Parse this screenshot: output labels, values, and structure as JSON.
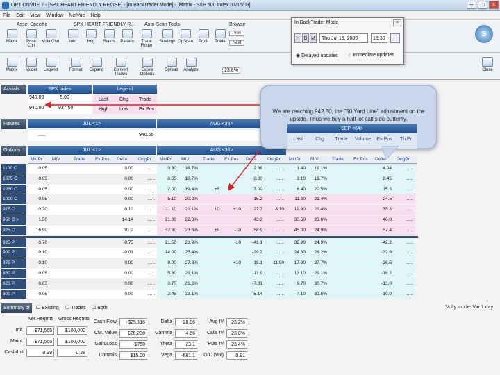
{
  "window": {
    "title": "OPTIONVUE 7 - [SPX HEART FRIENDLY REVISE] - [In BackTrader Mode] - [Matrix - S&P 500 Index 07/15/09]"
  },
  "menu": [
    "File",
    "Edit",
    "View",
    "Window",
    "NetVue",
    "Help"
  ],
  "ribbon1": {
    "groups": [
      "Asset Specific",
      "SPX HEART FRIENDLY R...",
      "Auto-Scan Tools",
      "Browse"
    ],
    "buttons": [
      "Matrix",
      "Price Chrt",
      "Vola Chrt",
      "Info",
      "Hog",
      "Status",
      "Pattern",
      "Trade Finder",
      "Strategy",
      "OpScan",
      "Profit",
      "Trade"
    ],
    "browse": [
      "Prev",
      "Next"
    ]
  },
  "ribbon2": {
    "buttons": [
      "Matrix",
      "Model",
      "Legend",
      "Format",
      "Expand",
      "Convert Trades",
      "Expire Options",
      "Spread",
      "Analyze"
    ],
    "pct": "23.8%"
  },
  "right_buttons": {
    "badge_s": "S",
    "close": "Close"
  },
  "popup": {
    "title": "In BackTrader Mode",
    "date": "Thu Jul 16, 2009",
    "time": "16:30",
    "radio1": "Delayed updates",
    "radio2": "Immediate updates",
    "btn_h": "H",
    "btn_d": "D",
    "btn_m": "M"
  },
  "bubble": {
    "text": "We are reaching 942.50, the \"50 Yard Line\" adjustment on the upside. Thus we buy a half lot call side butterfly."
  },
  "actuals": {
    "label": "Actuals",
    "symbol": "SPX Index",
    "legend": "Legend",
    "rows": [
      [
        "940.00",
        "-5.00"
      ],
      [
        "940.00",
        "937.50"
      ]
    ],
    "legend_rows": [
      [
        "Last",
        "Chg",
        "Trade"
      ],
      [
        "High",
        "Low",
        "Ex.Pos"
      ]
    ]
  },
  "futures": {
    "label": "Futures",
    "jul": "JUL <1>",
    "aug": "AUG <36>",
    "sep": "SEP <64>",
    "dots": "......",
    "val": "940.65"
  },
  "options": {
    "label": "Options",
    "jul": "JUL <1>",
    "aug": "AUG <36>",
    "sep": "SEP <64>",
    "sep_cols": [
      "Last",
      "Chg",
      "Trade",
      "Volume",
      "Ex.Pos",
      "Th.Pr"
    ],
    "cols": [
      "MktPr",
      "MIV",
      "Trade",
      "Ex.Pos",
      "Delta",
      "OrigPr",
      "MktPr",
      "MIV",
      "Trade",
      "Ex.Pos",
      "Delta",
      "OrigPr",
      "MktPr",
      "MIV",
      "Trade",
      "Ex.Pos",
      "Delta",
      "OrigPr"
    ],
    "rows": [
      {
        "k": "1100 C",
        "v": [
          "0.05",
          "",
          "",
          "",
          "0.00",
          "......",
          "0.30",
          "18.7%",
          "",
          "",
          "2.88",
          "......",
          "1.40",
          "19.1%",
          "",
          "",
          "4.04",
          "......"
        ]
      },
      {
        "k": "1075 C",
        "v": [
          "0.05",
          "",
          "",
          "",
          "0.00",
          "......",
          "0.85",
          "18.7%",
          "",
          "",
          "6.00",
          "......",
          "3.10",
          "19.7%",
          "",
          "",
          "8.45",
          "......"
        ]
      },
      {
        "k": "1050 C",
        "v": [
          "0.05",
          "",
          "",
          "",
          "0.00",
          "......",
          "2.00",
          "19.4%",
          "+5",
          "",
          "7.00",
          "......",
          "6.40",
          "20.5%",
          "",
          "",
          "15.3",
          "......"
        ]
      },
      {
        "k": "1000 C",
        "v": [
          "0.05",
          "",
          "",
          "",
          "0.00",
          "......",
          "5.10",
          "20.2%",
          "",
          "",
          "15.2",
          "......",
          "11.60",
          "21.4%",
          "",
          "",
          "24.5",
          "......"
        ]
      },
      {
        "k": "975 C",
        "v": [
          "0.20",
          "",
          "",
          "",
          "0.12",
          "......",
          "11.10",
          "21.1%",
          "10",
          "+10",
          "27.7",
          "8.10",
          "19.90",
          "22.4%",
          "",
          "",
          "35.3",
          "......"
        ]
      },
      {
        "k": "950 C >",
        "v": [
          "1.50",
          "",
          "",
          "",
          "14.14",
          "......",
          "21.00",
          "22.3%",
          "",
          "",
          "43.2",
          "......",
          "30.50",
          "23.6%",
          "",
          "",
          "46.8",
          "......"
        ]
      },
      {
        "k": "925 C",
        "v": [
          "16.90",
          "",
          "",
          "",
          "91.2",
          "......",
          "32.80",
          "23.6%",
          "+5",
          "-10",
          "58.9",
          "......",
          "45.00",
          "24.9%",
          "",
          "",
          "57.4",
          "......"
        ]
      },
      {
        "k": "925 P",
        "v": [
          "0.70",
          "",
          "",
          "",
          "-8.75",
          "......",
          "21.50",
          "23.9%",
          "",
          "-10",
          "-41.1",
          "......",
          "32.90",
          "24.9%",
          "",
          "",
          "-42.2",
          "......"
        ]
      },
      {
        "k": "900 P",
        "v": [
          "0.10",
          "",
          "",
          "",
          "-0.01",
          "......",
          "14.00",
          "25.4%",
          "",
          "",
          "-29.2",
          "......",
          "24.30",
          "26.2%",
          "",
          "",
          "-32.6",
          "......"
        ]
      },
      {
        "k": "875 P",
        "v": [
          "0.10",
          "",
          "",
          "",
          "0.00",
          "......",
          "9.00",
          "27.3%",
          "",
          "+10",
          "18.1",
          "11.90",
          "17.90",
          "27.7%",
          "",
          "",
          "-26.5",
          "......"
        ]
      },
      {
        "k": "850 P",
        "v": [
          "0.05",
          "",
          "",
          "",
          "0.00",
          "......",
          "5.80",
          "29.1%",
          "",
          "",
          "-11.9",
          "......",
          "13.10",
          "29.1%",
          "",
          "",
          "-18.2",
          "......"
        ]
      },
      {
        "k": "825 P",
        "v": [
          "0.05",
          "",
          "",
          "",
          "0.00",
          "......",
          "3.70",
          "31.2%",
          "",
          "",
          "-7.81",
          "......",
          "9.70",
          "30.7%",
          "",
          "",
          "-13.0",
          "......"
        ]
      },
      {
        "k": "800 P",
        "v": [
          "0.05",
          "",
          "",
          "",
          "0.00",
          "......",
          "2.45",
          "33.1%",
          "",
          "",
          "-5.14",
          "......",
          "7.10",
          "32.5%",
          "",
          "",
          "-10.0",
          "......"
        ]
      }
    ]
  },
  "summary": {
    "label": "Summary of",
    "chk_existing": "Existing",
    "chk_trades": "Trades",
    "chk_both": "Both",
    "volty": "Volty mode: Var 1 day",
    "headers": [
      "Net Reqmts",
      "Gross Reqmts"
    ],
    "row_labels": [
      "Init.",
      "Maint.",
      "Cash/Init"
    ],
    "net": [
      "$71,565",
      "$71,565",
      "0.39"
    ],
    "gross": [
      "$100,000",
      "$100,000",
      "0.28"
    ],
    "mid_labels": [
      "Cash Flow",
      "Cur. Value",
      "Gain/Loss",
      "Commis"
    ],
    "mid_vals": [
      "+$25,116",
      "$26,230",
      "-$750",
      "$15.00"
    ],
    "greek_labels": [
      "Delta",
      "Gamma",
      "Theta",
      "Vega"
    ],
    "greek_vals": [
      "-28.06",
      "4.56",
      "23.1",
      "-681.1"
    ],
    "iv_labels": [
      "Avg IV",
      "Calls IV",
      "Puts IV",
      "O/C (Vol)"
    ],
    "iv_vals": [
      "23.2%",
      "23.0%",
      "23.4%",
      "0.91"
    ]
  }
}
